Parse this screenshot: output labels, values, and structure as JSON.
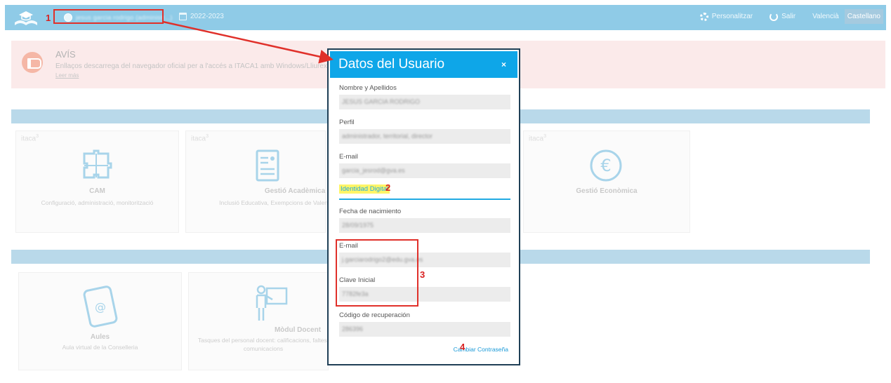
{
  "header": {
    "user_label": "jesus garcia rodrigo (administr...)",
    "year": "2022-2023",
    "personalize": "Personalitzar",
    "logout": "Salir",
    "lang_valencia": "Valencià",
    "lang_castellano": "Castellano"
  },
  "notice": {
    "title": "AVÍS",
    "text": "Enllaços descarrega del navegador oficial per a l'accés a ITACA1 amb Windows/Lliurex/Mac",
    "link": "Leer más"
  },
  "tiles": {
    "brand": "itaca",
    "brand_sup": "3",
    "cam": {
      "name": "CAM",
      "desc": "Configuració, administració, monitorització"
    },
    "gestio_academica": {
      "name": "Gestió Acadèmica",
      "desc": "Inclusió Educativa, Exempcions de Valencià"
    },
    "gestio_economica": {
      "name": "Gestió Econòmica",
      "desc": ""
    },
    "aules": {
      "name": "Aules",
      "desc": "Aula virtual de la Conselleria"
    },
    "modul_docent": {
      "name": "Mòdul Docent",
      "desc": "Tasques del personal docent: calificacions, faltes, comunicacions"
    }
  },
  "modal": {
    "title": "Datos del Usuario",
    "close": "×",
    "fields": {
      "nombre_label": "Nombre y Apellidos",
      "nombre_value": "JESUS GARCIA RODRIGO",
      "perfil_label": "Perfil",
      "perfil_value": "administrador, territorial, director",
      "email_label": "E-mail",
      "email_value": "garcia_jesrod@gva.es",
      "section": "Identidad Digital",
      "fecha_label": "Fecha de nacimiento",
      "fecha_value": "28/09/1975",
      "email2_label": "E-mail",
      "email2_value": "j.garciarodrigo2@edu.gva.es",
      "clave_label": "Clave Inicial",
      "clave_value": "7782fe3a",
      "codigo_label": "Código de recuperación",
      "codigo_value": "286396"
    },
    "change_password": "Cambiar Contraseña"
  },
  "annotations": {
    "n1": "1",
    "n2": "2",
    "n3": "3",
    "n4": "4"
  },
  "colors": {
    "topbar": "#8fcbe7",
    "modal_header": "#0ea6e8",
    "annotation_red": "#e0302a",
    "highlight": "#fff566"
  }
}
